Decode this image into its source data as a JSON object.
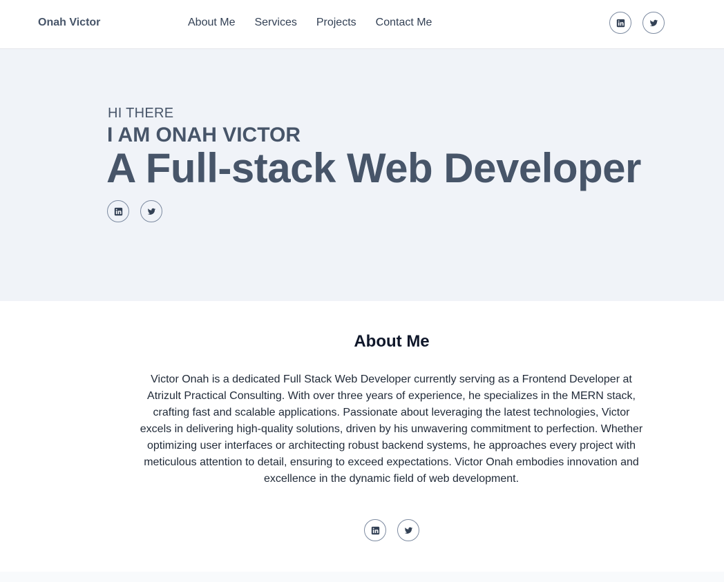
{
  "nav": {
    "brand": "Onah Victor",
    "links": [
      "About Me",
      "Services",
      "Projects",
      "Contact Me"
    ],
    "social_icons": [
      "linkedin-icon",
      "twitter-icon"
    ]
  },
  "hero": {
    "greeting": "HI THERE",
    "name": "I AM ONAH VICTOR",
    "title": "A Full-stack Web Developer"
  },
  "about": {
    "heading": "About Me",
    "text": "Victor Onah is a dedicated Full Stack Web Developer currently serving as a Frontend Developer at Atrizult Practical Consulting. With over three years of experience, he specializes in the MERN stack, crafting fast and scalable applications. Passionate about leveraging the latest technologies, Victor excels in delivering high-quality solutions, driven by his unwavering commitment to perfection. Whether optimizing user interfaces or architecting robust backend systems, he approaches every project with meticulous attention to detail, ensuring to exceed expectations. Victor Onah embodies innovation and excellence in the dynamic field of web development."
  },
  "colors": {
    "accent": "#475569",
    "hero_background": "#f0f3f8",
    "icon_border": "#7c8aa0"
  }
}
